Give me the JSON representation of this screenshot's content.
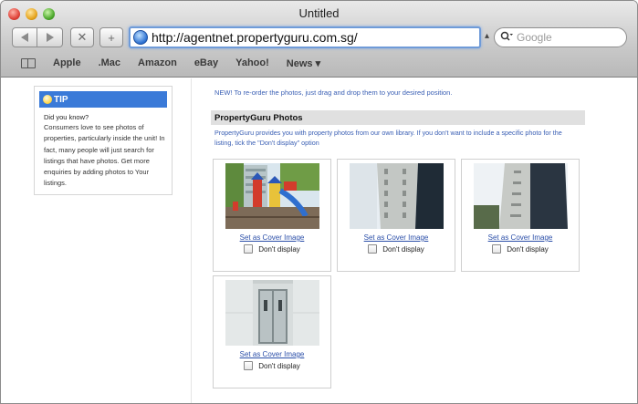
{
  "window": {
    "title": "Untitled"
  },
  "toolbar": {
    "back_icon": "back-arrow-icon",
    "forward_icon": "forward-arrow-icon",
    "stop_label": "✕",
    "add_label": "+",
    "url": "http://agentnet.propertyguru.com.sg/",
    "search_placeholder": "Google"
  },
  "bookmarks": [
    "Apple",
    ".Mac",
    "Amazon",
    "eBay",
    "Yahoo!",
    "News ▾"
  ],
  "tip": {
    "heading": "TIP",
    "question": "Did you know?",
    "body": "Consumers love to see photos of properties, particularly inside the unit! In fact, many people will just search for listings that have photos. Get more enquiries by adding photos to Your listings."
  },
  "main": {
    "notice": "NEW! To re-order the photos, just drag and drop them to your desired position.",
    "section_title": "PropertyGuru Photos",
    "description": "PropertyGuru provides you with property photos from our own library. If you don't want to include a specific photo for the listing, tick the \"Don't display\" option",
    "photos": [
      {
        "subject": "playground",
        "cover_label": "Set as Cover Image",
        "dont_display_label": "Don't display"
      },
      {
        "subject": "apartment-block",
        "cover_label": "Set as Cover Image",
        "dont_display_label": "Don't display"
      },
      {
        "subject": "apartment-block-angle",
        "cover_label": "Set as Cover Image",
        "dont_display_label": "Don't display"
      },
      {
        "subject": "elevator-doors",
        "cover_label": "Set as Cover Image",
        "dont_display_label": "Don't display"
      }
    ]
  }
}
